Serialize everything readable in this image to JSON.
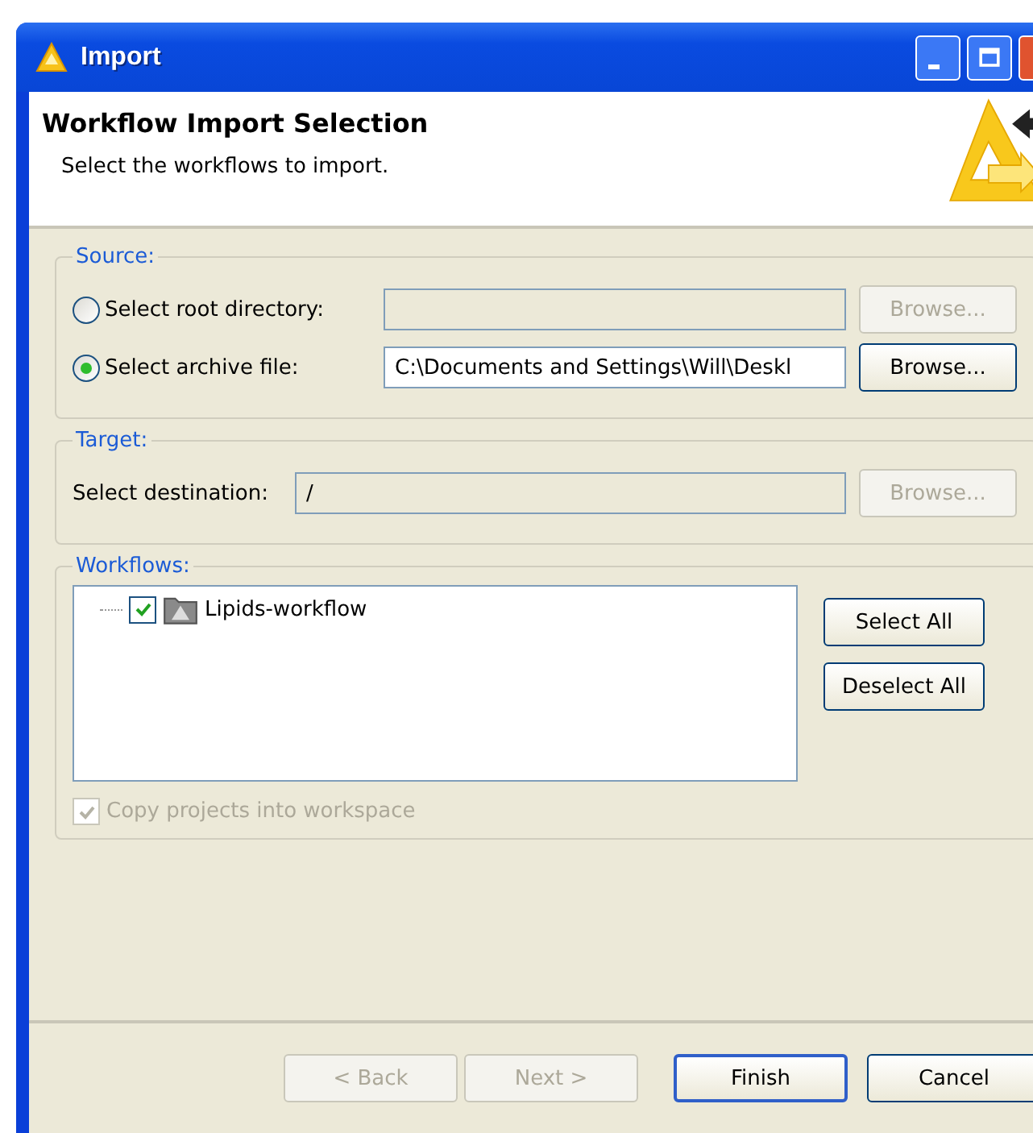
{
  "window": {
    "title": "Import"
  },
  "header": {
    "title": "Workflow Import Selection",
    "subtitle": "Select the workflows to import."
  },
  "source": {
    "label": "Source:",
    "rows": [
      {
        "label": "Select root directory:",
        "selected": false,
        "value": "",
        "browse": {
          "label": "Browse...",
          "disabled": true
        }
      },
      {
        "label": "Select archive file:",
        "selected": true,
        "value": "C:\\Documents and Settings\\Will\\Deskl",
        "browse": {
          "label": "Browse...",
          "disabled": false
        }
      }
    ]
  },
  "target": {
    "label": "Target:",
    "field_label": "Select destination:",
    "value": "/",
    "browse": {
      "label": "Browse...",
      "disabled": true
    }
  },
  "workflows": {
    "label": "Workflows:",
    "items": [
      {
        "label": "Lipids-workflow",
        "checked": true
      }
    ],
    "buttons": [
      "Select All",
      "Deselect All"
    ],
    "copy": {
      "label": "Copy projects into workspace",
      "checked": true,
      "disabled": true
    }
  },
  "footer": [
    {
      "label": "< Back",
      "disabled": true,
      "default": false
    },
    {
      "label": "Next >",
      "disabled": true,
      "default": false
    },
    {
      "label": "Finish",
      "disabled": false,
      "default": true
    },
    {
      "label": "Cancel",
      "disabled": false,
      "default": false
    }
  ]
}
